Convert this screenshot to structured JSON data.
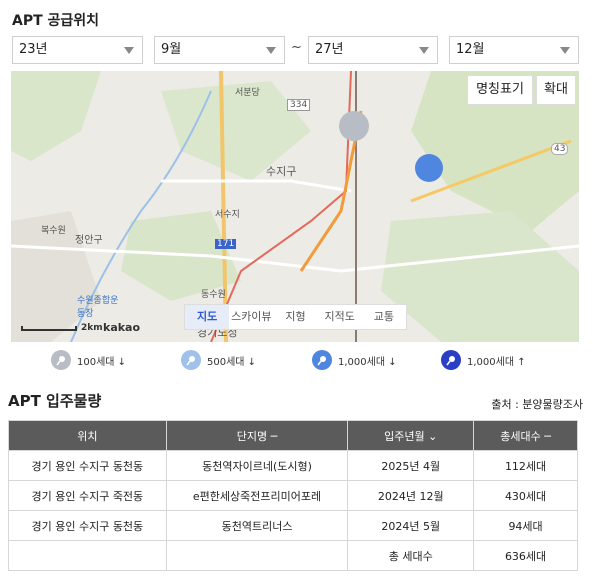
{
  "supply_section": {
    "title": "APT 공급위치"
  },
  "filters": {
    "start_year": "23년",
    "start_month": "9월",
    "separator": "~",
    "end_year": "27년",
    "end_month": "12월"
  },
  "map": {
    "buttons": {
      "landmark": "명칭표기",
      "zoom": "확대"
    },
    "tabs": [
      "지도",
      "스카이뷰",
      "지형",
      "지적도",
      "교통"
    ],
    "labels": [
      "서분당",
      "334",
      "수지구",
      "서수지",
      "복수원",
      "정안구",
      "171",
      "수원종합운동장",
      "동수원",
      "경기도청",
      "43"
    ],
    "scale_text": "2km",
    "brand": "kakao"
  },
  "legend": [
    {
      "label": "100세대 ↓",
      "color": "#b8bcc4"
    },
    {
      "label": "500세대 ↓",
      "color": "#9fc1ec"
    },
    {
      "label": "1,000세대 ↓",
      "color": "#4f86e0"
    },
    {
      "label": "1,000세대 ↑",
      "color": "#2b3ec6"
    }
  ],
  "move_in_section": {
    "title": "APT 입주물량",
    "source": "출처 : 분양물량조사"
  },
  "table": {
    "headers": [
      "위치",
      "단지명 ─",
      "입주년월 ⌄",
      "총세대수 ─"
    ],
    "rows": [
      [
        "경기 용인 수지구 동천동",
        "동천역자이르네(도시형)",
        "2025년 4월",
        "112세대"
      ],
      [
        "경기 용인 수지구 죽전동",
        "e편한세상죽전프리미어포레",
        "2024년 12월",
        "430세대"
      ],
      [
        "경기 용인 수지구 동천동",
        "동천역트리너스",
        "2024년 5월",
        "94세대"
      ]
    ],
    "total_label": "총 세대수",
    "total_value": "636세대"
  }
}
